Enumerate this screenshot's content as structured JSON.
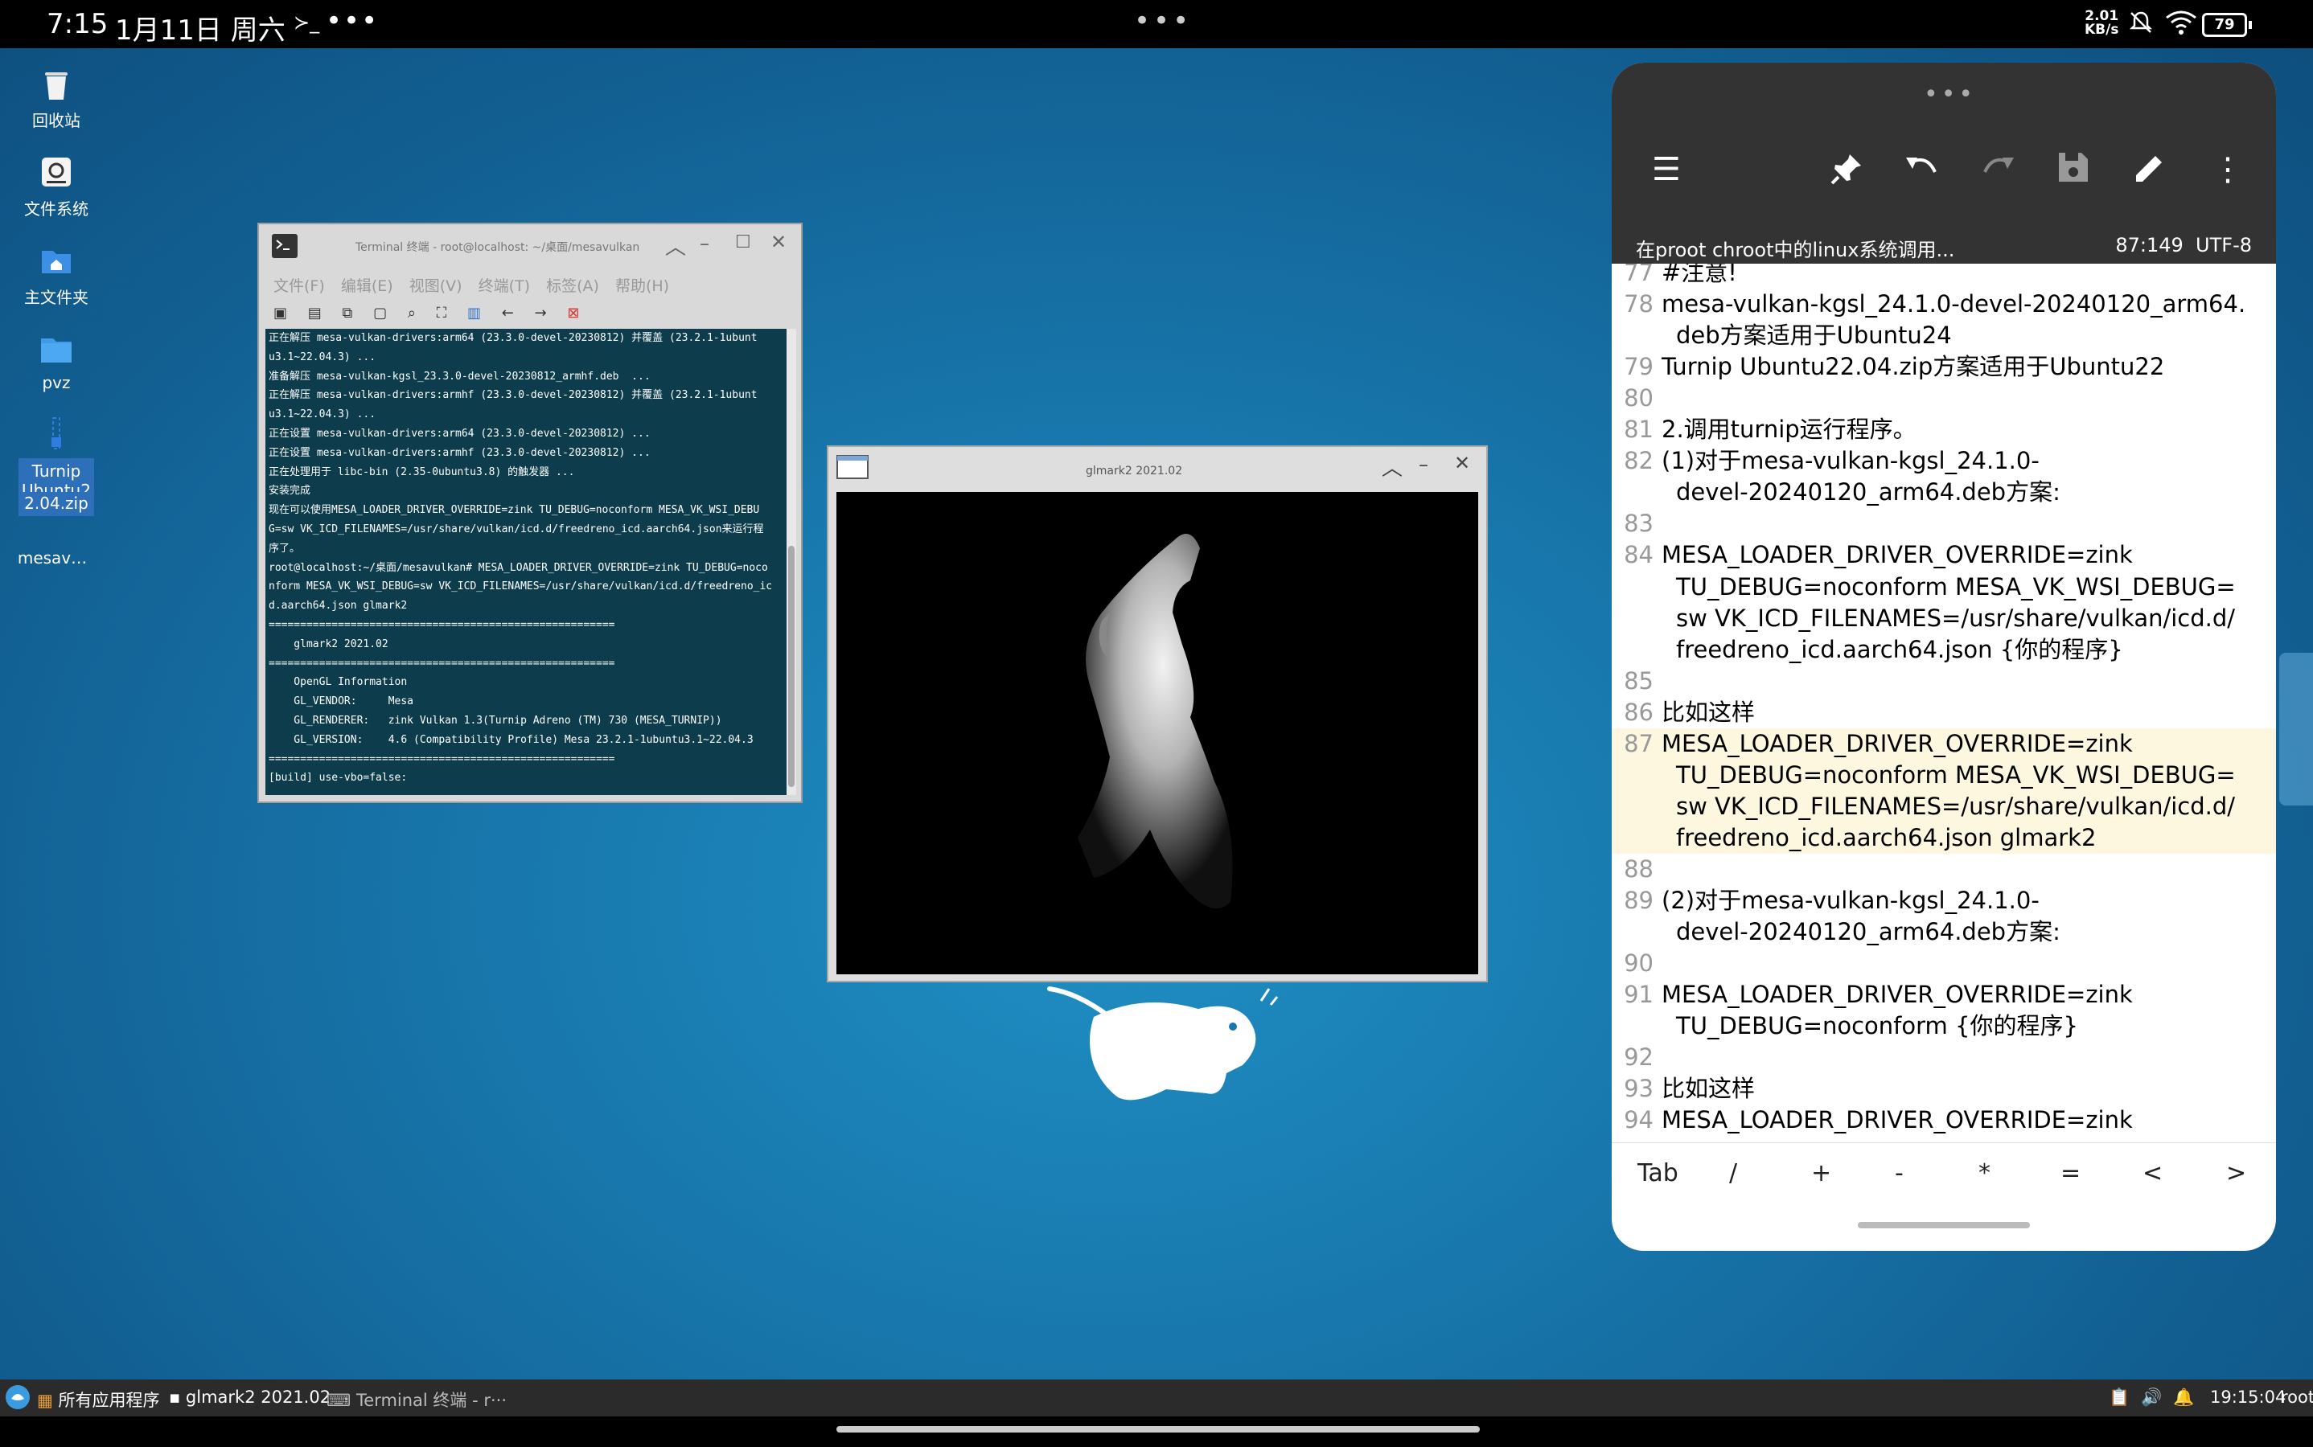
{
  "status_bar": {
    "time": "7:15",
    "date": "1月11日 周六",
    "terminal_glyph": "≻_",
    "more": "•••",
    "center_handle": "•••",
    "net_speed_value": "2.01",
    "net_speed_unit": "KB/s",
    "battery": "79"
  },
  "desktop": {
    "icons": [
      {
        "label": "回收站",
        "icon": "trash-icon"
      },
      {
        "label": "文件系统",
        "icon": "drive-icon"
      },
      {
        "label": "主文件夹",
        "icon": "home-folder-icon"
      },
      {
        "label": "pvz",
        "icon": "folder-icon"
      },
      {
        "label": "Turnip Ubuntu2 2.04.zip",
        "label_line1": "Turnip",
        "label_line2": "Ubuntu2",
        "label_line3": "2.04.zip",
        "icon": "zip-icon"
      },
      {
        "label": "mesav…",
        "icon": "file-icon"
      }
    ]
  },
  "terminal": {
    "title": "Terminal 终端 - root@localhost: ~/桌面/mesavulkan",
    "menu": [
      "文件(F)",
      "编辑(E)",
      "视图(V)",
      "终端(T)",
      "标签(A)",
      "帮助(H)"
    ],
    "toolbar": [
      "new-tab-icon",
      "new-window-icon",
      "copy-icon",
      "paste-icon",
      "search-icon",
      "fullscreen-icon",
      "split-icon",
      "back-icon",
      "forward-icon",
      "close-tab-icon"
    ],
    "output": "正在解压 mesa-vulkan-drivers:arm64 (23.3.0-devel-20230812) 并覆盖 (23.2.1-1ubunt\nu3.1~22.04.3) ...\n准备解压 mesa-vulkan-kgsl_23.3.0-devel-20230812_armhf.deb  ...\n正在解压 mesa-vulkan-drivers:armhf (23.3.0-devel-20230812) 并覆盖 (23.2.1-1ubunt\nu3.1~22.04.3) ...\n正在设置 mesa-vulkan-drivers:arm64 (23.3.0-devel-20230812) ...\n正在设置 mesa-vulkan-drivers:armhf (23.3.0-devel-20230812) ...\n正在处理用于 libc-bin (2.35-0ubuntu3.8) 的触发器 ...\n安装完成\n现在可以使用MESA_LOADER_DRIVER_OVERRIDE=zink TU_DEBUG=noconform MESA_VK_WSI_DEBU\nG=sw VK_ICD_FILENAMES=/usr/share/vulkan/icd.d/freedreno_icd.aarch64.json来运行程\n序了。\nroot@localhost:~/桌面/mesavulkan# MESA_LOADER_DRIVER_OVERRIDE=zink TU_DEBUG=noco\nnform MESA_VK_WSI_DEBUG=sw VK_ICD_FILENAMES=/usr/share/vulkan/icd.d/freedreno_ic\nd.aarch64.json glmark2\n=======================================================\n    glmark2 2021.02\n=======================================================\n    OpenGL Information\n    GL_VENDOR:     Mesa\n    GL_RENDERER:   zink Vulkan 1.3(Turnip Adreno (TM) 730 (MESA_TURNIP))\n    GL_VERSION:    4.6 (Compatibility Profile) Mesa 23.2.1-1ubuntu3.1~22.04.3\n=======================================================\n[build] use-vbo=false:"
  },
  "glmark": {
    "title": "glmark2 2021.02"
  },
  "editor": {
    "toolbar_icons": [
      "menu-icon",
      "pin-icon",
      "undo-icon",
      "redo-icon",
      "save-icon",
      "edit-icon",
      "more-vert-icon"
    ],
    "file_title": "在proot chroot中的linux系统调用...",
    "cursor_pos": "87:149",
    "encoding": "UTF-8",
    "lines": [
      {
        "n": "77",
        "text": "#注意!"
      },
      {
        "n": "78",
        "text": "mesa-vulkan-kgsl_24.1.0-devel-20240120_arm64."
      },
      {
        "n": "",
        "text": "deb方案适用于Ubuntu24"
      },
      {
        "n": "79",
        "text": "Turnip  Ubuntu22.04.zip方案适用于Ubuntu22"
      },
      {
        "n": "80",
        "text": ""
      },
      {
        "n": "81",
        "text": "2.调用turnip运行程序。"
      },
      {
        "n": "82",
        "text": "(1)对于mesa-vulkan-kgsl_24.1.0-"
      },
      {
        "n": "",
        "text": "devel-20240120_arm64.deb方案:"
      },
      {
        "n": "83",
        "text": ""
      },
      {
        "n": "84",
        "text": "MESA_LOADER_DRIVER_OVERRIDE=zink"
      },
      {
        "n": "",
        "text": "TU_DEBUG=noconform  MESA_VK_WSI_DEBUG="
      },
      {
        "n": "",
        "text": "sw  VK_ICD_FILENAMES=/usr/share/vulkan/icd.d/"
      },
      {
        "n": "",
        "text": "freedreno_icd.aarch64.json {你的程序}"
      },
      {
        "n": "85",
        "text": ""
      },
      {
        "n": "86",
        "text": "比如这样"
      },
      {
        "n": "87",
        "text": "MESA_LOADER_DRIVER_OVERRIDE=zink"
      },
      {
        "n": "",
        "text": "TU_DEBUG=noconform  MESA_VK_WSI_DEBUG="
      },
      {
        "n": "",
        "text": "sw  VK_ICD_FILENAMES=/usr/share/vulkan/icd.d/"
      },
      {
        "n": "",
        "text": "freedreno_icd.aarch64.json  glmark2"
      },
      {
        "n": "88",
        "text": ""
      },
      {
        "n": "89",
        "text": "(2)对于mesa-vulkan-kgsl_24.1.0-"
      },
      {
        "n": "",
        "text": "devel-20240120_arm64.deb方案:"
      },
      {
        "n": "90",
        "text": ""
      },
      {
        "n": "91",
        "text": "MESA_LOADER_DRIVER_OVERRIDE=zink"
      },
      {
        "n": "",
        "text": "TU_DEBUG=noconform {你的程序}"
      },
      {
        "n": "92",
        "text": ""
      },
      {
        "n": "93",
        "text": "比如这样"
      },
      {
        "n": "94",
        "text": "MESA_LOADER_DRIVER_OVERRIDE=zink"
      }
    ],
    "keys": [
      "Tab",
      "/",
      "+",
      "-",
      "*",
      "=",
      "<",
      ">"
    ]
  },
  "taskbar": {
    "apps_label": "所有应用程序",
    "window1": "glmark2 2021.02",
    "window2": "Terminal 终端 - r···",
    "clock": "19:15:04",
    "user": "root"
  }
}
